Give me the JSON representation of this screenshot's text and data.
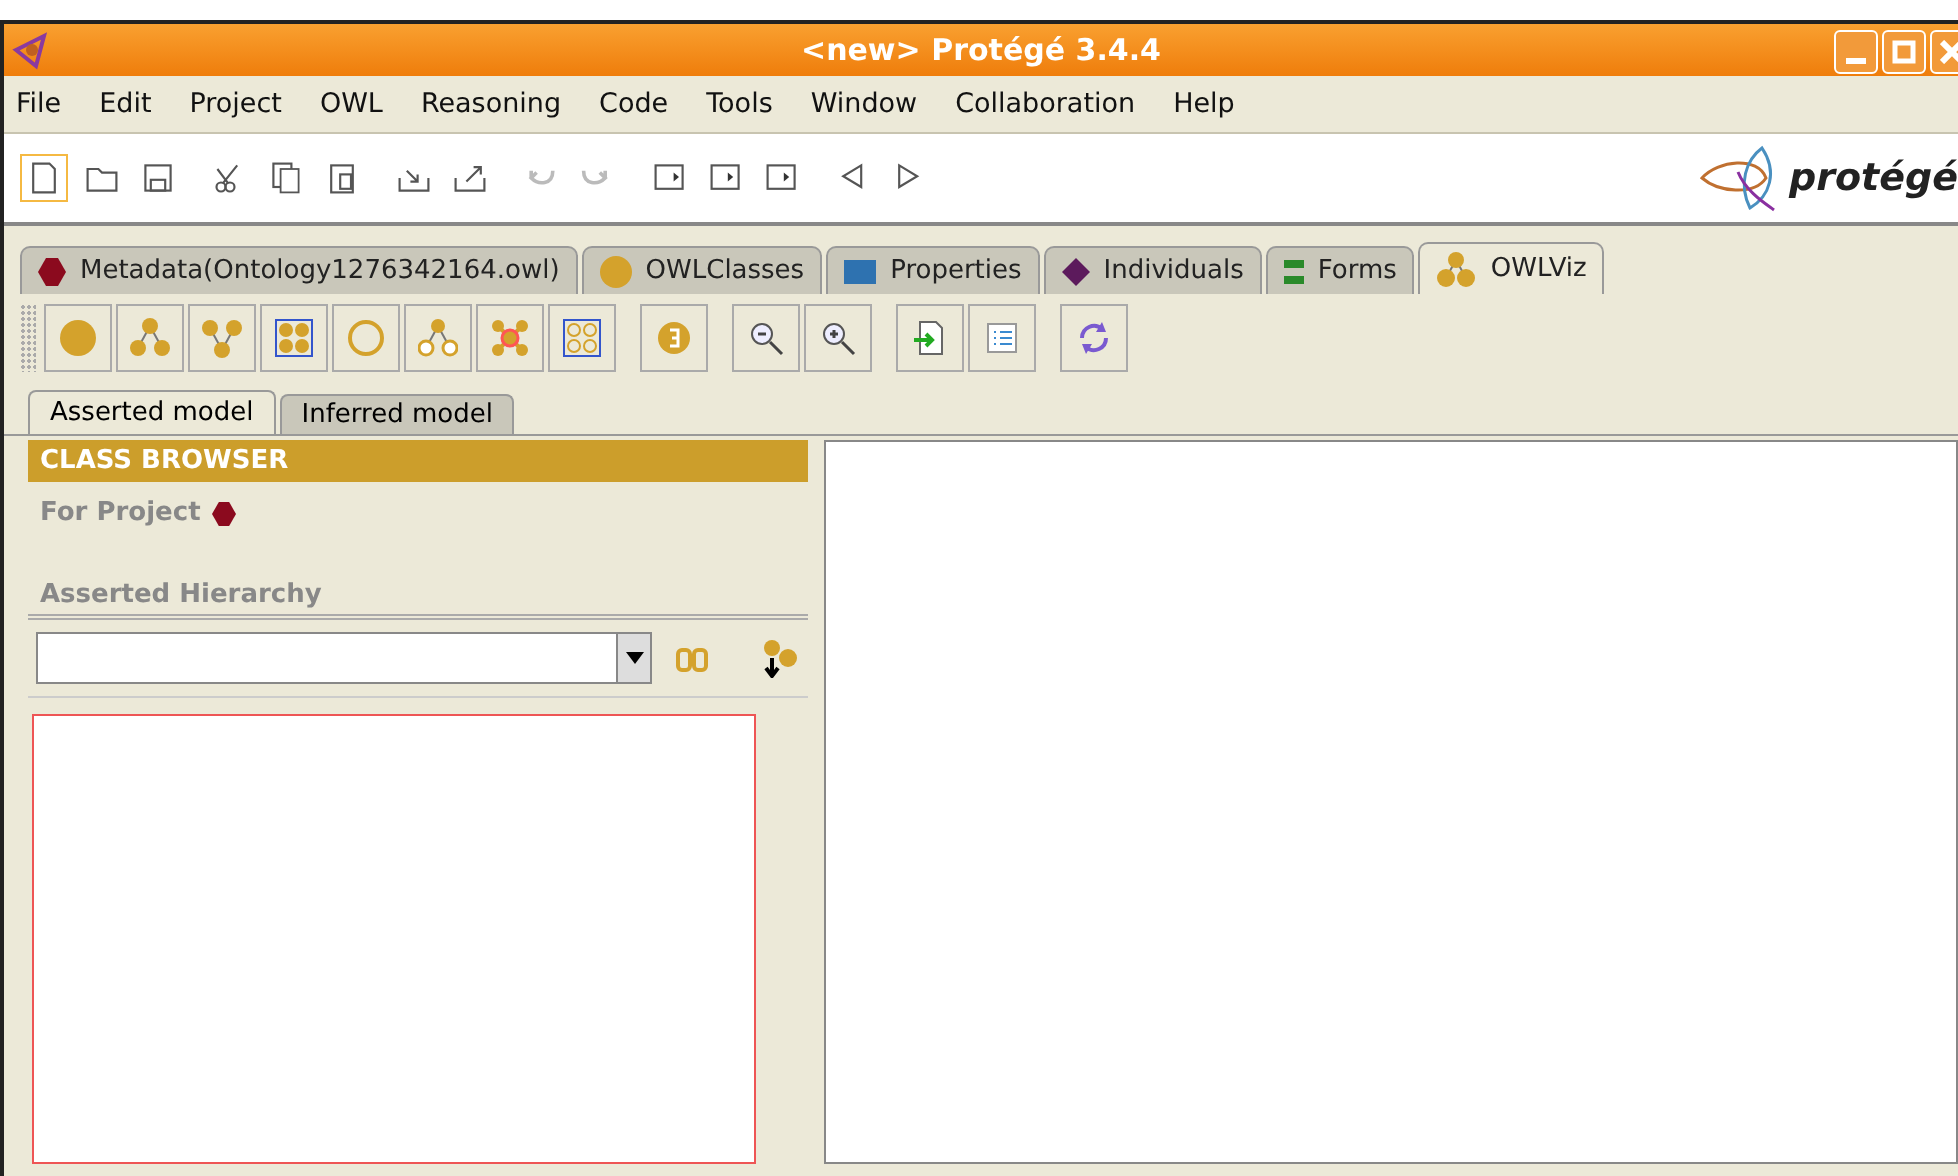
{
  "window": {
    "title": "<new>  Protégé 3.4.4"
  },
  "menu": [
    "File",
    "Edit",
    "Project",
    "OWL",
    "Reasoning",
    "Code",
    "Tools",
    "Window",
    "Collaboration",
    "Help"
  ],
  "logo": {
    "text": "protégé"
  },
  "tabs": [
    {
      "label": "Metadata(Ontology1276342164.owl)",
      "kind": "metadata",
      "selected": false
    },
    {
      "label": "OWLClasses",
      "kind": "classes",
      "selected": false
    },
    {
      "label": "Properties",
      "kind": "properties",
      "selected": false
    },
    {
      "label": "Individuals",
      "kind": "individuals",
      "selected": false
    },
    {
      "label": "Forms",
      "kind": "forms",
      "selected": false
    },
    {
      "label": "OWLViz",
      "kind": "owlviz",
      "selected": true
    }
  ],
  "model_tabs": [
    {
      "label": "Asserted model",
      "selected": true
    },
    {
      "label": "Inferred model",
      "selected": false
    }
  ],
  "class_browser": {
    "title": "CLASS BROWSER",
    "for_project": "For Project",
    "hierarchy": "Asserted Hierarchy"
  }
}
